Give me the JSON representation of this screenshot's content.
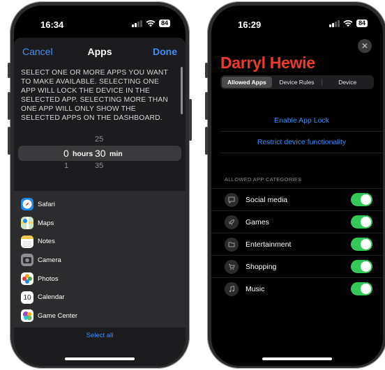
{
  "left_phone": {
    "status": {
      "time": "16:34",
      "battery": "84"
    },
    "nav": {
      "cancel": "Cancel",
      "title": "Apps",
      "done": "Done"
    },
    "instructions": "SELECT ONE OR MORE APPS YOU WANT TO MAKE AVAILABLE. SELECTING ONE APP WILL LOCK THE DEVICE IN THE SELECTED APP. SELECTING MORE THAN ONE APP WILL ONLY SHOW THE SELECTED APPS ON THE DASHBOARD.",
    "picker": {
      "above_min": "25",
      "hours_value": "0",
      "hours_label": "hours",
      "min_value": "30",
      "min_label": "min",
      "below_hours": "1",
      "below_min": "35"
    },
    "apps": [
      {
        "label": "Safari",
        "icon": "safari-icon"
      },
      {
        "label": "Maps",
        "icon": "maps-icon"
      },
      {
        "label": "Notes",
        "icon": "notes-icon"
      },
      {
        "label": "Camera",
        "icon": "camera-icon"
      },
      {
        "label": "Photos",
        "icon": "photos-icon"
      },
      {
        "label": "Calendar",
        "icon": "calendar-icon",
        "badge": "10"
      },
      {
        "label": "Game Center",
        "icon": "game-center-icon"
      }
    ],
    "select_all": "Select all"
  },
  "right_phone": {
    "status": {
      "time": "16:29",
      "battery": "84"
    },
    "name": "Darryl Hewie",
    "tabs": [
      {
        "label": "Allowed Apps",
        "active": true
      },
      {
        "label": "Device Rules",
        "active": false
      },
      {
        "label": "Device",
        "active": false
      }
    ],
    "links": [
      "Enable App Lock",
      "Restrict device functionality"
    ],
    "categories_header": "ALLOWED APP CATEGORIES",
    "categories": [
      {
        "label": "Social media",
        "icon": "chat-bubble-icon",
        "enabled": true
      },
      {
        "label": "Games",
        "icon": "rocket-icon",
        "enabled": true
      },
      {
        "label": "Entertainment",
        "icon": "folder-icon",
        "enabled": true
      },
      {
        "label": "Shopping",
        "icon": "shopping-cart-icon",
        "enabled": true
      },
      {
        "label": "Music",
        "icon": "music-note-icon",
        "enabled": true
      }
    ],
    "colors": {
      "accent": "#3d8ef7",
      "name": "#ef3b2d",
      "toggle_on": "#34c759"
    }
  }
}
